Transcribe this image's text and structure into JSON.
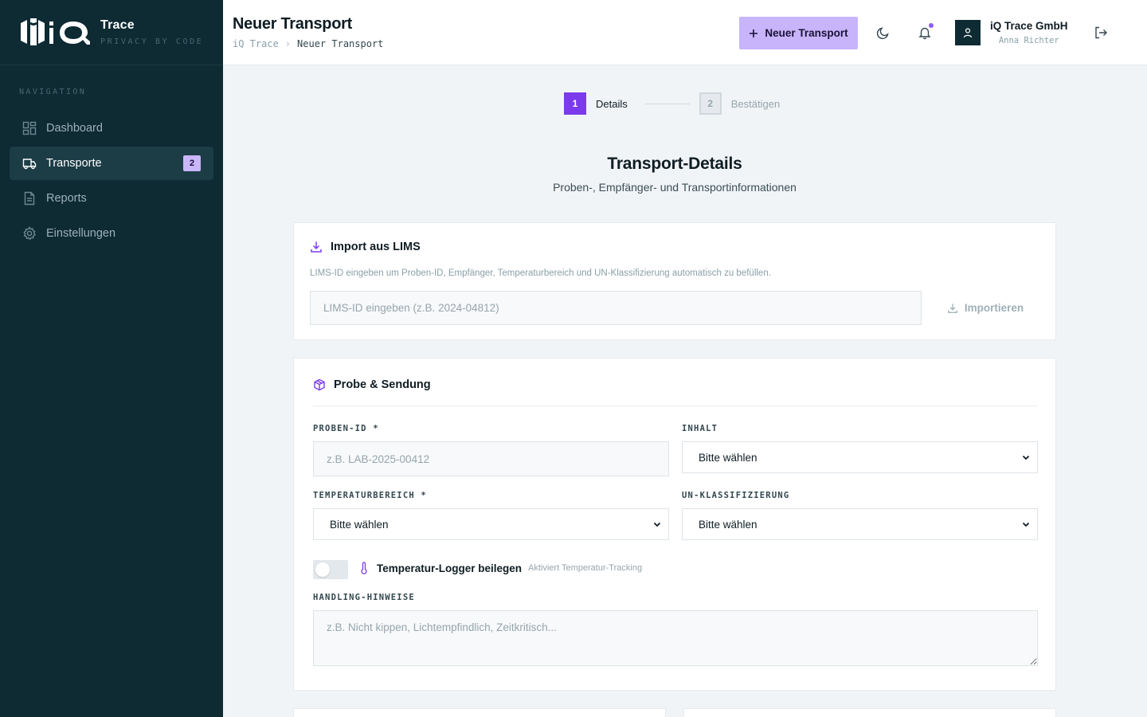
{
  "sidebar": {
    "brand_name": "Trace",
    "brand_tagline": "PRIVACY BY CODE",
    "nav_heading": "NAVIGATION",
    "items": [
      {
        "label": "Dashboard",
        "icon": "dashboard-icon"
      },
      {
        "label": "Transporte",
        "icon": "truck-icon",
        "badge": "2",
        "active": true
      },
      {
        "label": "Reports",
        "icon": "document-icon"
      },
      {
        "label": "Einstellungen",
        "icon": "gear-icon"
      }
    ]
  },
  "header": {
    "title": "Neuer Transport",
    "breadcrumb": {
      "root": "iQ Trace",
      "separator": "›",
      "current": "Neuer Transport"
    },
    "new_button": "Neuer Transport",
    "org_name": "iQ Trace GmbH",
    "user_name": "Anna Richter"
  },
  "stepper": {
    "steps": [
      {
        "number": "1",
        "label": "Details",
        "active": true
      },
      {
        "number": "2",
        "label": "Bestätigen",
        "active": false
      }
    ]
  },
  "section": {
    "title": "Transport-Details",
    "subtitle": "Proben-, Empfänger- und Transportinformationen"
  },
  "import_card": {
    "title": "Import aus LIMS",
    "description": "LIMS-ID eingeben um Proben-ID, Empfänger, Temperaturbereich und UN-Klassifizierung automatisch zu befüllen.",
    "input_placeholder": "LIMS-ID eingeben (z.B. 2024-04812)",
    "button": "Importieren"
  },
  "probe_card": {
    "title": "Probe & Sendung",
    "fields": {
      "proben_id": {
        "label": "PROBEN-ID *",
        "placeholder": "z.B. LAB-2025-00412"
      },
      "inhalt": {
        "label": "INHALT",
        "value": "Bitte wählen"
      },
      "temperatur": {
        "label": "TEMPERATURBEREICH *",
        "value": "Bitte wählen"
      },
      "un": {
        "label": "UN-KLASSIFIZIERUNG",
        "value": "Bitte wählen"
      },
      "handling": {
        "label": "HANDLING-HINWEISE",
        "placeholder": "z.B. Nicht kippen, Lichtempfindlich, Zeitkritisch..."
      }
    },
    "logger": {
      "label": "Temperatur-Logger beilegen",
      "hint": "Aktiviert Temperatur-Tracking",
      "enabled": false
    }
  },
  "colors": {
    "sidebar_bg": "#0e2a33",
    "accent": "#7c3aed",
    "accent_light": "#c7b4fa",
    "page_bg": "#f1f4f6"
  }
}
